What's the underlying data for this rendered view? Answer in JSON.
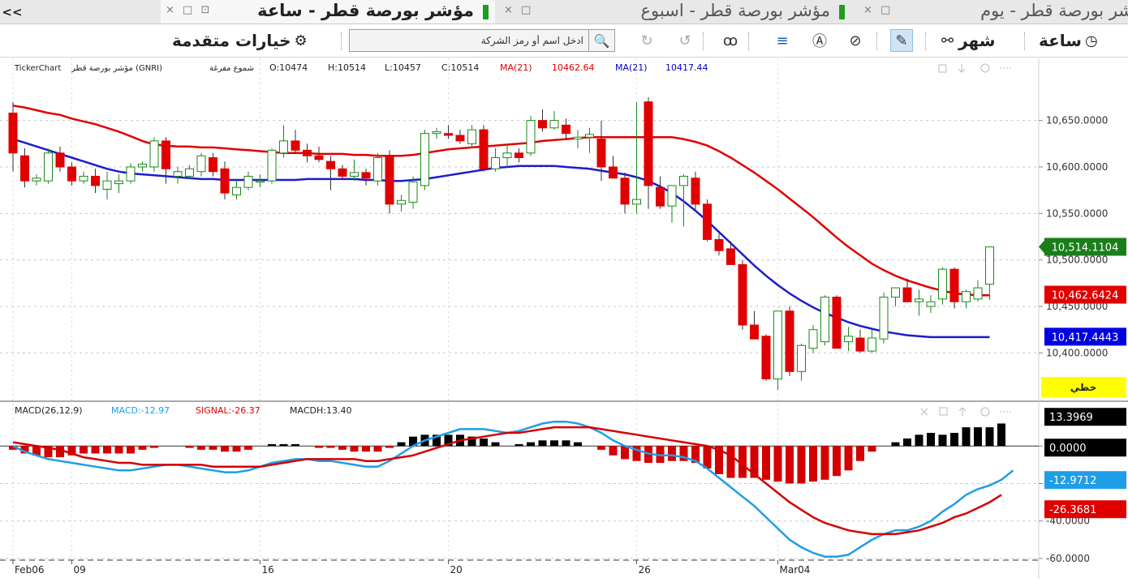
{
  "tabs": [
    {
      "title": "مؤشر بورصة قطر - ساعة",
      "active": true
    },
    {
      "title": "مؤشر بورصة قطر - اسبوع",
      "active": false
    },
    {
      "title": "شر بورصة قطر - يوم",
      "active": false
    }
  ],
  "tab_more": "<<",
  "tab_controls": "× □ ⊡",
  "toolbar": {
    "advanced_options": "خيارات متقدمة",
    "search_placeholder": "ادخل اسم أو رمز الشركة",
    "period_month": "شهر",
    "period_hour": "ساعة"
  },
  "chart_data": {
    "type": "candlestick",
    "info": {
      "source": "TickerChart",
      "name": "مؤشر بورصة قطر (GNRI)",
      "style": "شموع مفرغة",
      "open": "O:10474",
      "high": "H:10514",
      "low": "L:10457",
      "close": "C:10514",
      "ma1_label": "MA(21)",
      "ma1_value": "10462.64",
      "ma2_label": "MA(21)",
      "ma2_value": "10417.44"
    },
    "price_axis": {
      "ticks": [
        10650,
        10600,
        10550,
        10500,
        10450,
        10400
      ],
      "tick_labels": [
        "10,650.0000",
        "10,600.0000",
        "10,550.0000",
        "10,500.0000",
        "10,450.0000",
        "10,400.0000"
      ],
      "ylim": [
        10355,
        10695
      ]
    },
    "price_badges": [
      {
        "label": "10,514.1104",
        "value": 10514.1104,
        "color": "#1a7f1a"
      },
      {
        "label": "10,462.6424",
        "value": 10462.6424,
        "color": "#e00000"
      },
      {
        "label": "10,417.4443",
        "value": 10417.4443,
        "color": "#0000e0"
      }
    ],
    "scale_button": "خطي",
    "x_ticks": [
      {
        "label": "Feb06",
        "index": 0
      },
      {
        "label": "09",
        "index": 5
      },
      {
        "label": "16",
        "index": 21
      },
      {
        "label": "20",
        "index": 37
      },
      {
        "label": "26",
        "index": 53
      },
      {
        "label": "Mar04",
        "index": 65
      }
    ],
    "candles": [
      [
        10658,
        10670,
        10595,
        10615
      ],
      [
        10612,
        10620,
        10578,
        10585
      ],
      [
        10585,
        10592,
        10580,
        10588
      ],
      [
        10585,
        10620,
        10582,
        10615
      ],
      [
        10615,
        10622,
        10595,
        10600
      ],
      [
        10600,
        10605,
        10580,
        10585
      ],
      [
        10585,
        10595,
        10582,
        10590
      ],
      [
        10590,
        10598,
        10572,
        10580
      ],
      [
        10576,
        10595,
        10565,
        10585
      ],
      [
        10582,
        10592,
        10572,
        10585
      ],
      [
        10585,
        10604,
        10582,
        10600
      ],
      [
        10600,
        10606,
        10595,
        10603
      ],
      [
        10600,
        10632,
        10595,
        10628
      ],
      [
        10628,
        10632,
        10582,
        10598
      ],
      [
        10590,
        10600,
        10582,
        10595
      ],
      [
        10590,
        10602,
        10588,
        10598
      ],
      [
        10595,
        10615,
        10590,
        10612
      ],
      [
        10610,
        10615,
        10590,
        10595
      ],
      [
        10598,
        10606,
        10565,
        10572
      ],
      [
        10570,
        10585,
        10565,
        10578
      ],
      [
        10578,
        10595,
        10575,
        10590
      ],
      [
        10585,
        10592,
        10578,
        10585
      ],
      [
        10585,
        10620,
        10582,
        10618
      ],
      [
        10615,
        10645,
        10610,
        10628
      ],
      [
        10628,
        10640,
        10615,
        10618
      ],
      [
        10618,
        10625,
        10605,
        10612
      ],
      [
        10612,
        10622,
        10605,
        10608
      ],
      [
        10606,
        10612,
        10575,
        10598
      ],
      [
        10598,
        10602,
        10588,
        10590
      ],
      [
        10590,
        10608,
        10585,
        10594
      ],
      [
        10594,
        10598,
        10580,
        10588
      ],
      [
        10585,
        10615,
        10580,
        10610
      ],
      [
        10612,
        10618,
        10550,
        10560
      ],
      [
        10560,
        10570,
        10552,
        10564
      ],
      [
        10562,
        10590,
        10555,
        10584
      ],
      [
        10580,
        10640,
        10575,
        10636
      ],
      [
        10636,
        10642,
        10630,
        10638
      ],
      [
        10636,
        10645,
        10630,
        10634
      ],
      [
        10634,
        10640,
        10625,
        10628
      ],
      [
        10625,
        10645,
        10620,
        10640
      ],
      [
        10640,
        10645,
        10595,
        10598
      ],
      [
        10598,
        10620,
        10595,
        10610
      ],
      [
        10610,
        10625,
        10600,
        10615
      ],
      [
        10615,
        10620,
        10605,
        10610
      ],
      [
        10615,
        10655,
        10612,
        10650
      ],
      [
        10650,
        10662,
        10638,
        10642
      ],
      [
        10642,
        10660,
        10640,
        10650
      ],
      [
        10645,
        10652,
        10630,
        10636
      ],
      [
        10630,
        10640,
        10620,
        10632
      ],
      [
        10632,
        10642,
        10615,
        10635
      ],
      [
        10630,
        10650,
        10585,
        10600
      ],
      [
        10600,
        10612,
        10588,
        10588
      ],
      [
        10588,
        10594,
        10550,
        10560
      ],
      [
        10560,
        10670,
        10550,
        10565
      ],
      [
        10670,
        10675,
        10555,
        10580
      ],
      [
        10578,
        10590,
        10555,
        10558
      ],
      [
        10558,
        10580,
        10540,
        10580
      ],
      [
        10580,
        10592,
        10536,
        10590
      ],
      [
        10588,
        10595,
        10552,
        10560
      ],
      [
        10560,
        10565,
        10520,
        10522
      ],
      [
        10522,
        10528,
        10505,
        10510
      ],
      [
        10512,
        10520,
        10495,
        10495
      ],
      [
        10495,
        10500,
        10425,
        10430
      ],
      [
        10430,
        10445,
        10415,
        10415
      ],
      [
        10418,
        10420,
        10370,
        10372
      ],
      [
        10372,
        10445,
        10360,
        10445
      ],
      [
        10445,
        10450,
        10375,
        10380
      ],
      [
        10380,
        10410,
        10370,
        10408
      ],
      [
        10405,
        10430,
        10400,
        10425
      ],
      [
        10412,
        10462,
        10408,
        10460
      ],
      [
        10460,
        10462,
        10405,
        10405
      ],
      [
        10412,
        10428,
        10402,
        10418
      ],
      [
        10416,
        10425,
        10400,
        10402
      ],
      [
        10402,
        10425,
        10400,
        10416
      ],
      [
        10415,
        10465,
        10410,
        10460
      ],
      [
        10460,
        10468,
        10450,
        10470
      ],
      [
        10470,
        10480,
        10455,
        10455
      ],
      [
        10455,
        10468,
        10440,
        10458
      ],
      [
        10450,
        10462,
        10443,
        10455
      ],
      [
        10458,
        10492,
        10452,
        10490
      ],
      [
        10490,
        10492,
        10448,
        10455
      ],
      [
        10455,
        10468,
        10448,
        10466
      ],
      [
        10458,
        10478,
        10455,
        10470
      ],
      [
        10474,
        10514,
        10457,
        10514
      ]
    ],
    "ma_red": [
      10666,
      10664,
      10661,
      10658,
      10656,
      10652,
      10649,
      10646,
      10642,
      10638,
      10633,
      10628,
      10624,
      10623,
      10622,
      10622,
      10621,
      10621,
      10620,
      10619,
      10618,
      10617,
      10616,
      10615,
      10615,
      10615,
      10614,
      10614,
      10614,
      10613,
      10613,
      10612,
      10612,
      10612,
      10613,
      10615,
      10617,
      10619,
      10620,
      10621,
      10622,
      10623,
      10624,
      10625,
      10626,
      10628,
      10629,
      10630,
      10631,
      10632,
      10632,
      10632,
      10632,
      10632,
      10632,
      10632,
      10632,
      10630,
      10627,
      10623,
      10617,
      10610,
      10602,
      10594,
      10585,
      10576,
      10566,
      10556,
      10546,
      10535,
      10524,
      10514,
      10505,
      10496,
      10489,
      10483,
      10478,
      10474,
      10470,
      10467,
      10464,
      10463,
      10462,
      10462
    ],
    "ma_blue": [
      10630,
      10626,
      10622,
      10618,
      10614,
      10610,
      10606,
      10602,
      10598,
      10595,
      10593,
      10592,
      10591,
      10590,
      10589,
      10588,
      10587,
      10587,
      10586,
      10586,
      10586,
      10586,
      10586,
      10586,
      10586,
      10587,
      10587,
      10587,
      10587,
      10587,
      10586,
      10586,
      10585,
      10585,
      10586,
      10587,
      10589,
      10591,
      10593,
      10595,
      10597,
      10599,
      10600,
      10601,
      10601,
      10601,
      10601,
      10600,
      10599,
      10598,
      10596,
      10594,
      10592,
      10589,
      10585,
      10579,
      10572,
      10563,
      10553,
      10542,
      10530,
      10518,
      10506,
      10494,
      10483,
      10473,
      10464,
      10456,
      10449,
      10443,
      10438,
      10433,
      10429,
      10426,
      10423,
      10421,
      10419,
      10418,
      10417,
      10417,
      10417,
      10417,
      10417,
      10417
    ],
    "macd": {
      "title": "MACD(26,12,9)",
      "macd_label": "MACD:-12.97",
      "signal_label": "SIGNAL:-26.37",
      "hist_label": "MACDH:13.40",
      "ticks": [
        0,
        -20,
        -40,
        -60
      ],
      "tick_labels": [
        "0.0000",
        "-20.0000",
        "-40.0000",
        "-60.0000"
      ],
      "ylim": [
        -60,
        13.5
      ],
      "badges": [
        {
          "label": "13.3969",
          "value": 13.3969,
          "color": "#000000"
        },
        {
          "label": "0.0000",
          "value": 0,
          "color": "#000000"
        },
        {
          "label": "-12.9712",
          "value": -12.9712,
          "color": "#1e9ee6"
        },
        {
          "label": "-26.3681",
          "value": -26.3681,
          "color": "#e00000"
        }
      ],
      "macd": [
        0,
        -3,
        -5,
        -7,
        -8,
        -9,
        -10,
        -11,
        -12,
        -13,
        -13,
        -12,
        -11,
        -10,
        -10,
        -11,
        -12,
        -13,
        -14,
        -14,
        -13,
        -11,
        -9,
        -8,
        -7,
        -7,
        -8,
        -8,
        -9,
        -10,
        -11,
        -11,
        -8,
        -4,
        0,
        3,
        5,
        7,
        9,
        9,
        9,
        8,
        7,
        8,
        10,
        12,
        13,
        13,
        12,
        10,
        7,
        3,
        0,
        -2,
        -4,
        -5,
        -5,
        -6,
        -8,
        -12,
        -17,
        -22,
        -27,
        -32,
        -38,
        -44,
        -50,
        -54,
        -57,
        -59,
        -59,
        -58,
        -54,
        -50,
        -47,
        -45,
        -45,
        -43,
        -40,
        -35,
        -31,
        -26,
        -23,
        -21,
        -18,
        -13
      ],
      "signal": [
        2,
        1,
        0,
        -1,
        -2,
        -4,
        -6,
        -7,
        -8,
        -9,
        -9,
        -10,
        -10,
        -10,
        -10,
        -10,
        -10,
        -11,
        -11,
        -11,
        -11,
        -11,
        -10,
        -9,
        -8,
        -7,
        -7,
        -7,
        -7,
        -7,
        -8,
        -8,
        -7,
        -6,
        -5,
        -3,
        -1,
        1,
        3,
        4,
        5,
        6,
        7,
        7,
        8,
        9,
        10,
        10,
        10,
        10,
        9,
        8,
        7,
        6,
        5,
        4,
        3,
        2,
        1,
        0,
        -2,
        -5,
        -10,
        -15,
        -20,
        -25,
        -30,
        -34,
        -38,
        -41,
        -43,
        -45,
        -46,
        -47,
        -47,
        -47,
        -46,
        -45,
        -43,
        -41,
        -38,
        -36,
        -33,
        -30,
        -26
      ],
      "hist": [
        -2,
        -4,
        -5,
        -6,
        -6,
        -5,
        -4,
        -4,
        -4,
        -4,
        -4,
        -2,
        -1,
        0,
        0,
        -1,
        -2,
        -2,
        -3,
        -3,
        -2,
        0,
        1,
        1,
        1,
        0,
        -1,
        -1,
        -2,
        -3,
        -3,
        -3,
        -1,
        2,
        5,
        6,
        6,
        6,
        6,
        5,
        4,
        2,
        0,
        1,
        2,
        3,
        3,
        3,
        2,
        0,
        -2,
        -5,
        -7,
        -8,
        -9,
        -9,
        -8,
        -8,
        -9,
        -12,
        -15,
        -17,
        -17,
        -17,
        -18,
        -19,
        -20,
        -20,
        -19,
        -18,
        -16,
        -13,
        -8,
        -3,
        0,
        2,
        4,
        6,
        7,
        6,
        7,
        10,
        10,
        10,
        12
      ]
    }
  }
}
